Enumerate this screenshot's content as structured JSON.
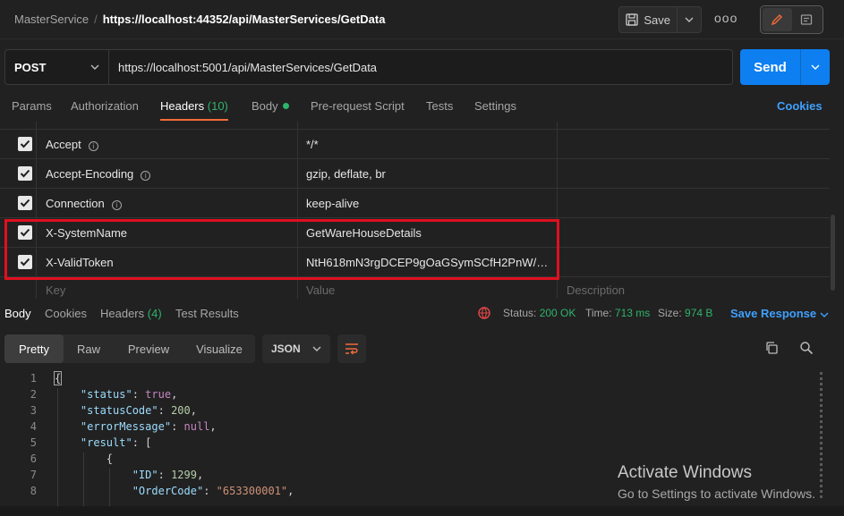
{
  "breadcrumb": {
    "parent": "MasterService",
    "separator": "/",
    "current": "https://localhost:44352/api/MasterServices/GetData"
  },
  "toolbar": {
    "save_label": "Save",
    "more_label": "ooo"
  },
  "request": {
    "method": "POST",
    "url": "https://localhost:5001/api/MasterServices/GetData",
    "send_label": "Send"
  },
  "request_tabs": {
    "params": "Params",
    "authorization": "Authorization",
    "headers": "Headers",
    "headers_count": "(10)",
    "body": "Body",
    "prescript": "Pre-request Script",
    "tests": "Tests",
    "settings": "Settings",
    "cookies": "Cookies"
  },
  "headers": [
    {
      "key": "Accept",
      "value": "*/*"
    },
    {
      "key": "Accept-Encoding",
      "value": "gzip, deflate, br"
    },
    {
      "key": "Connection",
      "value": "keep-alive"
    },
    {
      "key": "X-SystemName",
      "value": "GetWareHouseDetails"
    },
    {
      "key": "X-ValidToken",
      "value": "NtH618mN3rgDCEP9gOaGSymSCfH2PnW/DNi..."
    }
  ],
  "header_placeholders": {
    "key": "Key",
    "value": "Value",
    "description": "Description"
  },
  "response_tabs": {
    "body": "Body",
    "cookies": "Cookies",
    "headers": "Headers",
    "headers_count": "(4)",
    "test_results": "Test Results"
  },
  "response_status": {
    "status_label": "Status:",
    "status_value": "200 OK",
    "time_label": "Time:",
    "time_value": "713 ms",
    "size_label": "Size:",
    "size_value": "974 B",
    "save_response": "Save Response"
  },
  "format_tabs": {
    "pretty": "Pretty",
    "raw": "Raw",
    "preview": "Preview",
    "visualize": "Visualize",
    "language": "JSON"
  },
  "code_lines": [
    {
      "n": "1",
      "text": "{"
    },
    {
      "n": "2",
      "key": "\"status\"",
      "val": "true",
      "type": "kw"
    },
    {
      "n": "3",
      "key": "\"statusCode\"",
      "val": "200",
      "type": "n"
    },
    {
      "n": "4",
      "key": "\"errorMessage\"",
      "val": "null",
      "type": "kw"
    },
    {
      "n": "5",
      "key": "\"result\"",
      "val": "[",
      "type": "p"
    },
    {
      "n": "6",
      "text": "{"
    },
    {
      "n": "7",
      "key": "\"ID\"",
      "val": "1299",
      "type": "n"
    },
    {
      "n": "8",
      "key": "\"OrderCode\"",
      "val": "\"653300001\"",
      "type": "s"
    }
  ],
  "watermark": {
    "title": "Activate Windows",
    "subtitle": "Go to Settings to activate Windows."
  },
  "colors": {
    "accent": "#0d7ff0",
    "tab_underline": "#f26b3a",
    "success": "#2fb36b",
    "highlight": "#e0101f",
    "link": "#3fa0ff"
  }
}
